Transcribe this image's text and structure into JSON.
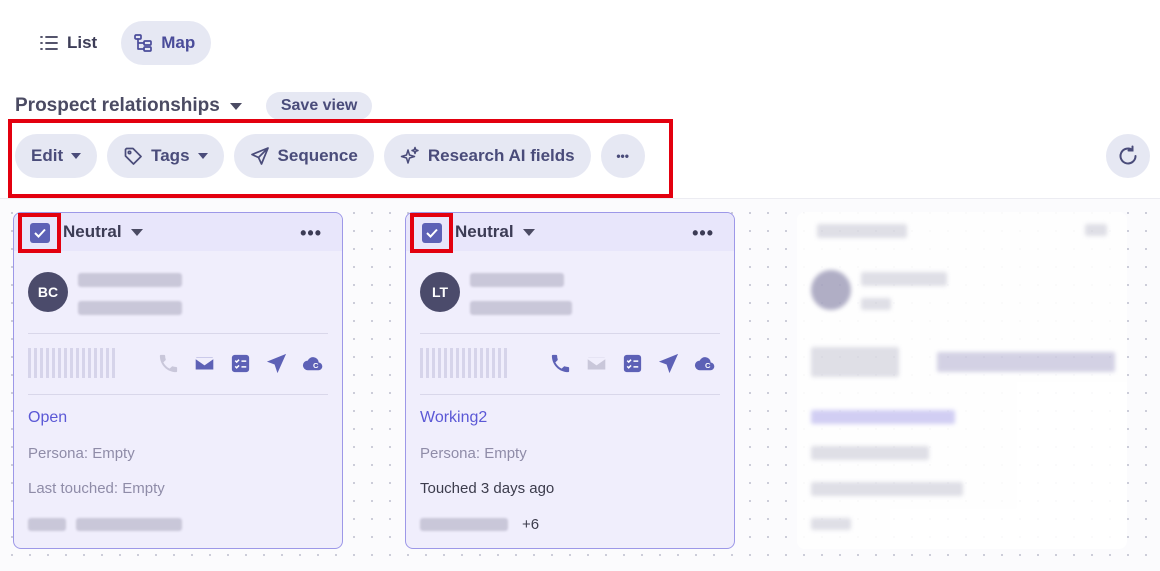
{
  "view_toggle": {
    "list_label": "List",
    "map_label": "Map",
    "active": "Map"
  },
  "view": {
    "title": "Prospect relationships",
    "save_label": "Save view"
  },
  "toolbar": {
    "edit_label": "Edit",
    "tags_label": "Tags",
    "sequence_label": "Sequence",
    "research_label": "Research AI fields",
    "more_label": "•••"
  },
  "cards": [
    {
      "sentiment": "Neutral",
      "checked": true,
      "initials": "BC",
      "stage": "Open",
      "persona": "Persona: Empty",
      "last_touched": "Last touched: Empty",
      "more_label": "•••"
    },
    {
      "sentiment": "Neutral",
      "checked": true,
      "initials": "LT",
      "stage": "Working2",
      "persona": "Persona: Empty",
      "last_touched": "Touched 3 days ago",
      "extra_count": "+6",
      "more_label": "•••"
    }
  ],
  "colors": {
    "accent": "#5d61b6",
    "highlight": "#e3000f",
    "card_border": "#9d98e8",
    "stage_link": "#5b58d6"
  },
  "icons": [
    "list-icon",
    "map-icon",
    "tag-icon",
    "send-icon",
    "sparkle-icon",
    "refresh-icon",
    "phone-icon",
    "mail-icon",
    "task-icon",
    "cloud-icon"
  ]
}
